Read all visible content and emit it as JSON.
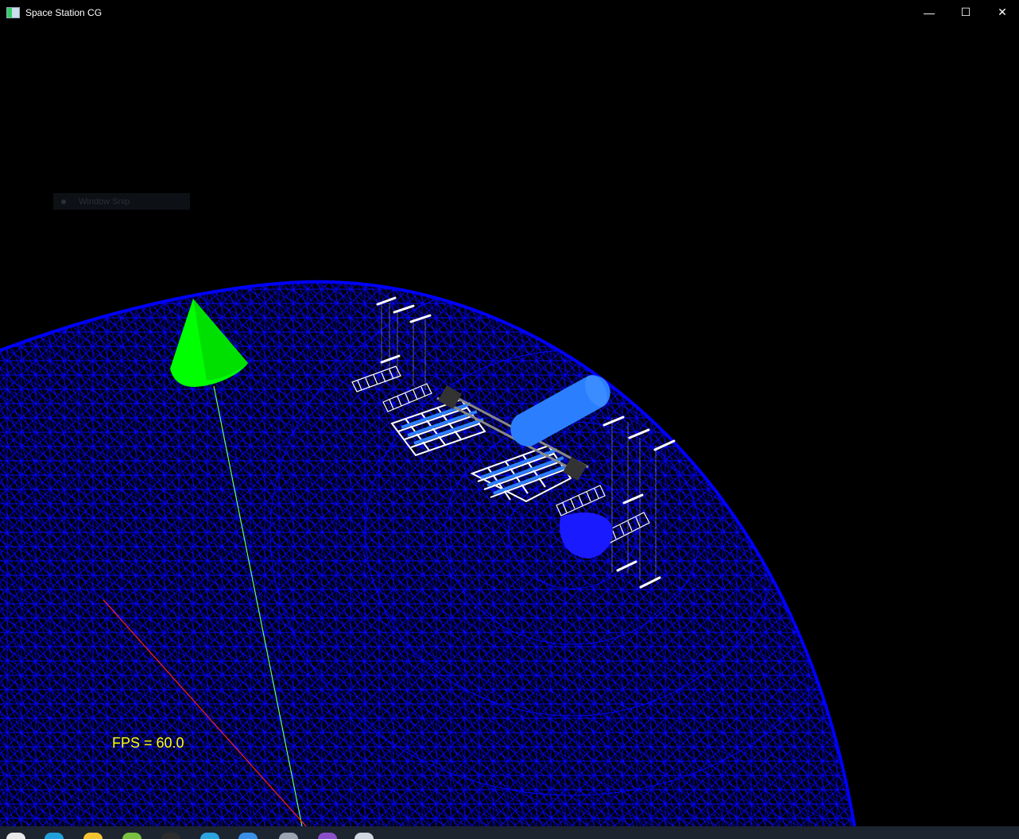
{
  "window": {
    "title": "Space Station CG",
    "controls": {
      "minimize": "—",
      "maximize": "☐",
      "close": "✕"
    }
  },
  "overlay": {
    "ghost_snip_label": "Window Snip"
  },
  "hud": {
    "fps_text": "FPS = 60.0"
  },
  "scene": {
    "planet_wireframe_color": "#0000ff",
    "cone_color": "#00ff00",
    "module_color": "#2b7fff",
    "green_axis_color": "#66ff66",
    "red_axis_color": "#ff2020",
    "truss_color": "#ffffff"
  },
  "taskbar": {
    "icons": [
      "windows-icon",
      "edge-icon",
      "explorer-icon",
      "app-icon",
      "search-icon",
      "telegram-icon",
      "chat-icon",
      "files-icon",
      "visual-studio-icon",
      "running-app-icon"
    ],
    "background": "#1c2430"
  }
}
